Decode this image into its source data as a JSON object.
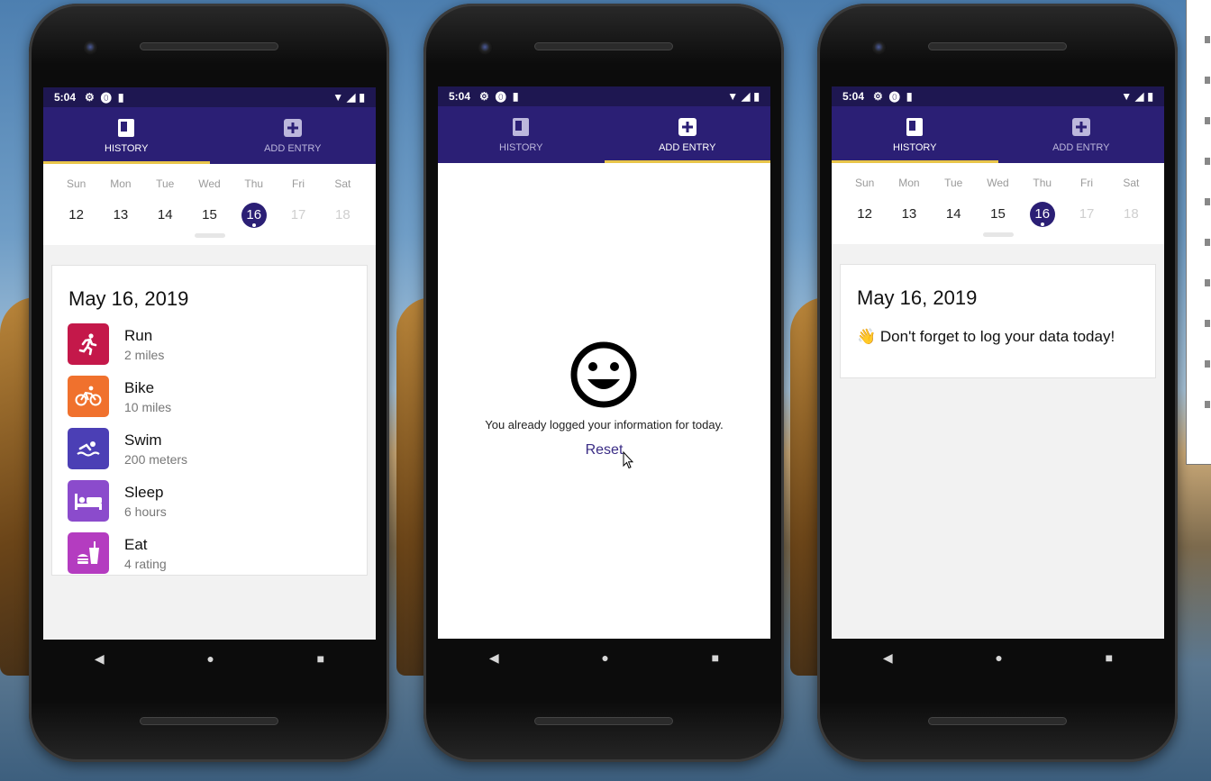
{
  "status_bar": {
    "time": "5:04"
  },
  "tabs": {
    "history": "HISTORY",
    "add_entry": "ADD ENTRY"
  },
  "calendar": {
    "days": [
      "Sun",
      "Mon",
      "Tue",
      "Wed",
      "Thu",
      "Fri",
      "Sat"
    ],
    "dates": [
      "12",
      "13",
      "14",
      "15",
      "16",
      "17",
      "18"
    ],
    "selected": "16"
  },
  "screen1": {
    "date_title": "May 16, 2019",
    "entries": [
      {
        "name": "Run",
        "value": "2 miles",
        "icon": "run-icon",
        "color": "#c4184a"
      },
      {
        "name": "Bike",
        "value": "10 miles",
        "icon": "bike-icon",
        "color": "#f0712d"
      },
      {
        "name": "Swim",
        "value": "200 meters",
        "icon": "swim-icon",
        "color": "#4b3fb5"
      },
      {
        "name": "Sleep",
        "value": "6 hours",
        "icon": "bed-icon",
        "color": "#8b4bcc"
      },
      {
        "name": "Eat",
        "value": "4 rating",
        "icon": "food-icon",
        "color": "#b43cc0"
      }
    ]
  },
  "screen2": {
    "message": "You already logged your information for today.",
    "reset_label": "Reset"
  },
  "screen3": {
    "date_title": "May 16, 2019",
    "reminder": "👋 Don't forget to log your data today!"
  },
  "colors": {
    "header": "#2b1f75",
    "statusbar": "#1e1751",
    "tab_indicator": "#e8c54a"
  }
}
